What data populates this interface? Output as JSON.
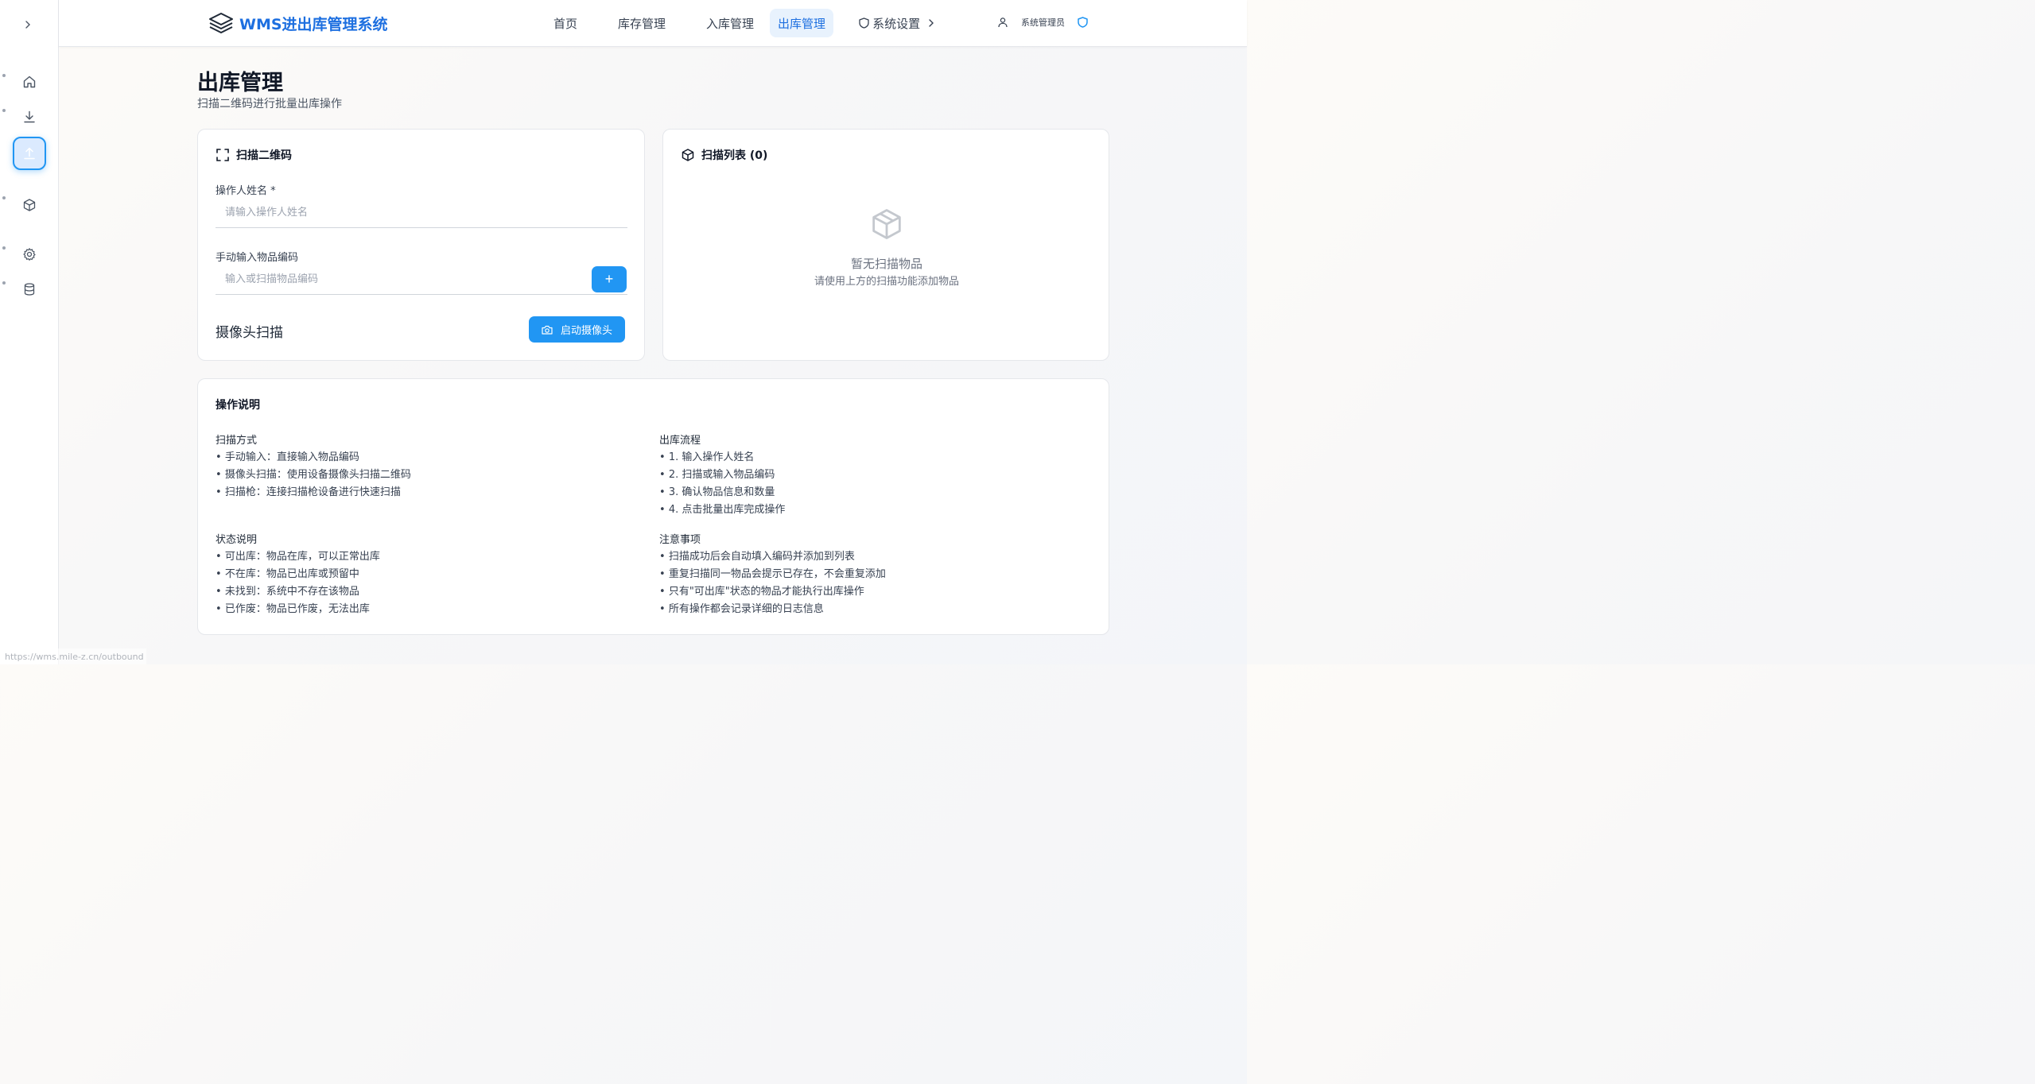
{
  "app": {
    "title": "WMS进出库管理系统"
  },
  "nav": {
    "items": [
      {
        "label": "首页"
      },
      {
        "label": "库存管理"
      },
      {
        "label": "入库管理"
      },
      {
        "label": "出库管理",
        "active": true
      },
      {
        "label": "系统设置"
      }
    ]
  },
  "user": {
    "name": "系统管理员"
  },
  "sidebar": {
    "icons": [
      "chevron-right-icon",
      "home-icon",
      "download-icon",
      "upload-icon",
      "box-icon",
      "gear-icon",
      "database-icon"
    ],
    "active": "upload-icon"
  },
  "page": {
    "title": "出库管理",
    "subtitle": "扫描二维码进行批量出库操作"
  },
  "scan": {
    "title": "扫描二维码",
    "operator_label": "操作人姓名 *",
    "operator_placeholder": "请输入操作人姓名",
    "code_label": "手动输入物品编码",
    "code_placeholder": "输入或扫描物品编码",
    "add_label": "+",
    "camera_label": "摄像头扫描",
    "camera_button": "启动摄像头"
  },
  "scan_list": {
    "title": "扫描列表 (0)",
    "empty_title": "暂无扫描物品",
    "empty_sub": "请使用上方的扫描功能添加物品"
  },
  "instructions": {
    "title": "操作说明",
    "sections": [
      {
        "title": "扫描方式",
        "items": [
          "手动输入：直接输入物品编码",
          "摄像头扫描：使用设备摄像头扫描二维码",
          "扫描枪：连接扫描枪设备进行快速扫描"
        ]
      },
      {
        "title": "出库流程",
        "items": [
          "1. 输入操作人姓名",
          "2. 扫描或输入物品编码",
          "3. 确认物品信息和数量",
          "4. 点击批量出库完成操作"
        ]
      },
      {
        "title": "状态说明",
        "items": [
          "可出库：物品在库，可以正常出库",
          "不在库：物品已出库或预留中",
          "未找到：系统中不存在该物品",
          "已作废：物品已作废，无法出库"
        ]
      },
      {
        "title": "注意事项",
        "items": [
          "扫描成功后会自动填入编码并添加到列表",
          "重复扫描同一物品会提示已存在，不会重复添加",
          "只有\"可出库\"状态的物品才能执行出库操作",
          "所有操作都会记录详细的日志信息"
        ]
      }
    ]
  },
  "status_bar": {
    "url": "https://wms.mile-z.cn/outbound"
  },
  "colors": {
    "accent": "#2196f3",
    "brand": "#1d6fe0"
  }
}
